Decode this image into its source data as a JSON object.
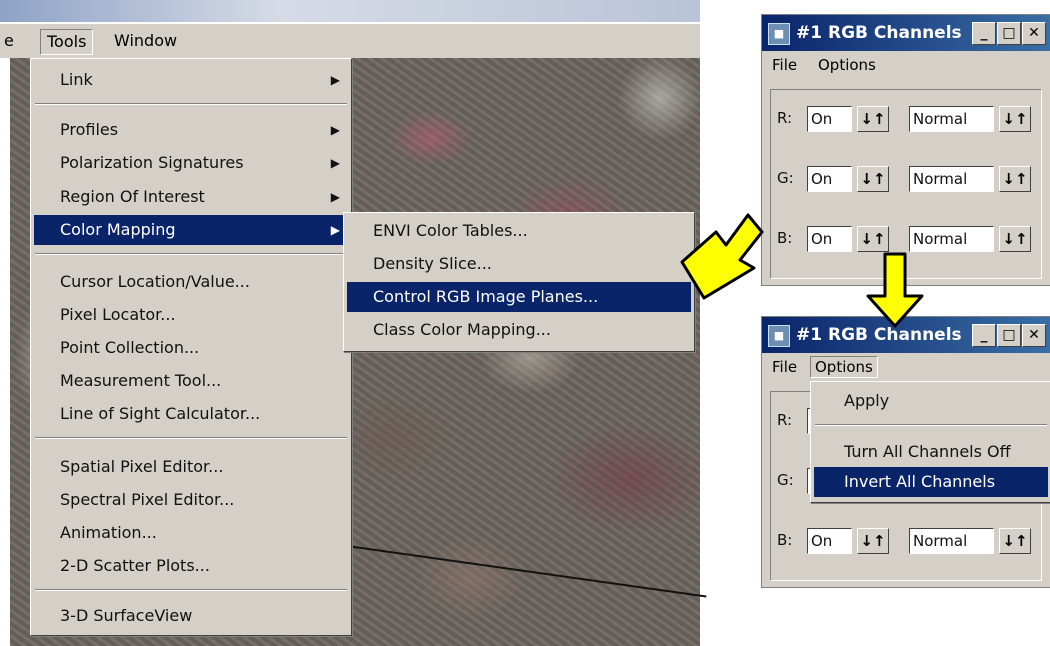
{
  "main_menu": {
    "partial_left": "e",
    "tools": "Tools",
    "window": "Window"
  },
  "tools_menu": {
    "items": [
      {
        "label": "Link",
        "submenu": true
      },
      {
        "label": "Profiles",
        "submenu": true
      },
      {
        "label": "Polarization Signatures",
        "submenu": true
      },
      {
        "label": "Region Of Interest",
        "submenu": true
      },
      {
        "label": "Color Mapping",
        "submenu": true,
        "selected": true
      },
      {
        "label": "Cursor Location/Value..."
      },
      {
        "label": "Pixel Locator..."
      },
      {
        "label": "Point Collection..."
      },
      {
        "label": "Measurement Tool..."
      },
      {
        "label": "Line of Sight Calculator..."
      },
      {
        "label": "Spatial Pixel Editor..."
      },
      {
        "label": "Spectral Pixel Editor..."
      },
      {
        "label": "Animation..."
      },
      {
        "label": "2-D Scatter Plots..."
      },
      {
        "label": "3-D SurfaceView"
      }
    ]
  },
  "color_mapping_menu": {
    "items": [
      {
        "label": "ENVI Color Tables..."
      },
      {
        "label": "Density Slice..."
      },
      {
        "label": "Control RGB Image Planes...",
        "selected": true
      },
      {
        "label": "Class Color Mapping..."
      }
    ]
  },
  "rgb_dialog_1": {
    "title": "#1 RGB Channels",
    "menu": {
      "file": "File",
      "options": "Options"
    },
    "channels": [
      {
        "label": "R:",
        "state": "On",
        "mode": "Normal"
      },
      {
        "label": "G:",
        "state": "On",
        "mode": "Normal"
      },
      {
        "label": "B:",
        "state": "On",
        "mode": "Normal"
      }
    ]
  },
  "rgb_dialog_2": {
    "title": "#1 RGB Channels",
    "menu": {
      "file": "File",
      "options": "Options"
    },
    "channels": [
      {
        "label": "R:",
        "state": "",
        "mode": ""
      },
      {
        "label": "G:",
        "state": "",
        "mode": ""
      },
      {
        "label": "B:",
        "state": "On",
        "mode": "Normal"
      }
    ],
    "options_menu": [
      {
        "label": "Apply"
      },
      {
        "label": "Turn All Channels Off"
      },
      {
        "label": "Invert All Channels",
        "selected": true
      }
    ]
  },
  "icons": {
    "submenu_arrow": "▶",
    "spin": "↓↑",
    "minimize": "_",
    "maximize": "□",
    "close": "✕"
  },
  "colors": {
    "selection": "#0a246a",
    "menu_bg": "#d4d0c8",
    "arrow_fill": "#ffff00"
  }
}
